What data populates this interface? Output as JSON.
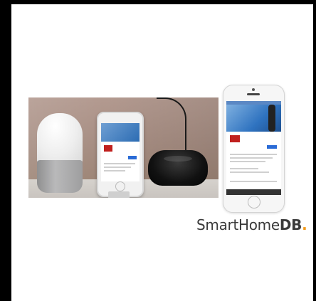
{
  "brand": {
    "name_light": "SmartHome",
    "name_bold": "DB",
    "dot": ".",
    "accent_color": "#f29a1b"
  },
  "scene": {
    "background": "#ffffff",
    "frame": "#000000"
  }
}
